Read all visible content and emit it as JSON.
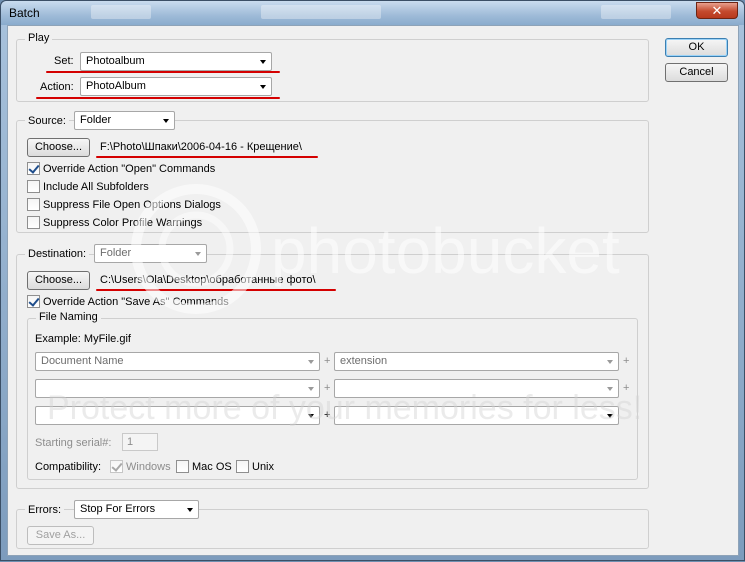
{
  "window": {
    "title": "Batch",
    "close_glyph": "✕"
  },
  "buttons": {
    "ok": "OK",
    "cancel": "Cancel"
  },
  "play": {
    "legend": "Play",
    "set_label": "Set:",
    "set_value": "Photoalbum",
    "action_label": "Action:",
    "action_value": "PhotoAlbum"
  },
  "source": {
    "label": "Source:",
    "value": "Folder",
    "choose_label": "Choose...",
    "path": "F:\\Photo\\Шпаки\\2006-04-16 - Крещение\\",
    "checkboxes": [
      {
        "label": "Override Action \"Open\" Commands",
        "checked": true
      },
      {
        "label": "Include All Subfolders",
        "checked": false
      },
      {
        "label": "Suppress File Open Options Dialogs",
        "checked": false
      },
      {
        "label": "Suppress Color Profile Warnings",
        "checked": false
      }
    ]
  },
  "destination": {
    "label": "Destination:",
    "value": "Folder",
    "choose_label": "Choose...",
    "path": "C:\\Users\\Ola\\Desktop\\обработанные фото\\",
    "override_label": "Override Action \"Save As\" Commands",
    "override_checked": true
  },
  "file_naming": {
    "legend": "File Naming",
    "example": "Example: MyFile.gif",
    "fields": [
      "Document Name",
      "extension",
      "",
      "",
      "",
      ""
    ],
    "plus": "+",
    "serial_label": "Starting serial#:",
    "serial_value": "1",
    "compat_label": "Compatibility:",
    "compat_options": [
      {
        "label": "Windows",
        "checked": true,
        "disabled": true
      },
      {
        "label": "Mac OS",
        "checked": false,
        "disabled": false
      },
      {
        "label": "Unix",
        "checked": false,
        "disabled": false
      }
    ]
  },
  "errors": {
    "label": "Errors:",
    "value": "Stop For Errors",
    "save_as_label": "Save As..."
  },
  "watermark": {
    "brand": "photobucket",
    "tagline": "Protect more of your memories for less!"
  },
  "colors": {
    "annotation": "#d40000",
    "accent": "#3c7fb1"
  }
}
